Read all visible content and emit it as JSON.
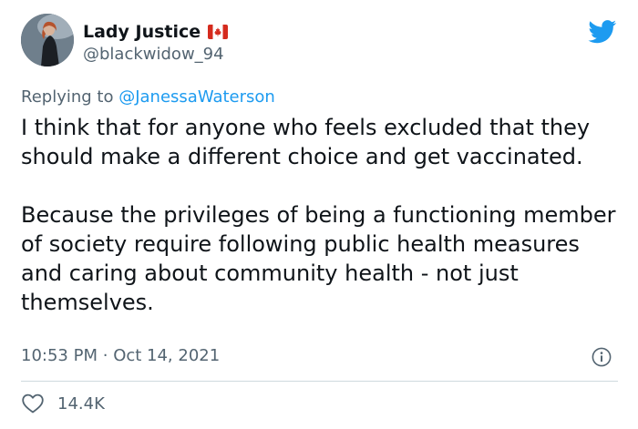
{
  "author": {
    "display_name": "Lady Justice",
    "flag_emoji": "canadian-flag",
    "handle": "@blackwidow_94",
    "avatar": "profile-avatar"
  },
  "reply": {
    "prefix": "Replying to",
    "mention": "@JanessaWaterson"
  },
  "tweet": {
    "paragraphs": [
      "I think that for anyone who feels excluded that they should make a different choice and get vaccinated.",
      "Because the privileges of being a functioning member of society require following public health measures and caring about community health - not just themselves."
    ],
    "time": "10:53 PM",
    "separator": "·",
    "date": "Oct 14, 2021"
  },
  "engagement": {
    "likes": "14.4K"
  },
  "icons": {
    "brand": "twitter-bird-icon",
    "info": "info-icon",
    "like": "heart-icon"
  },
  "colors": {
    "brand_blue": "#1d9bf0",
    "text_primary": "#0f1419",
    "text_secondary": "#536471",
    "divider": "#cfd9de",
    "flag_red": "#d52b1e"
  }
}
